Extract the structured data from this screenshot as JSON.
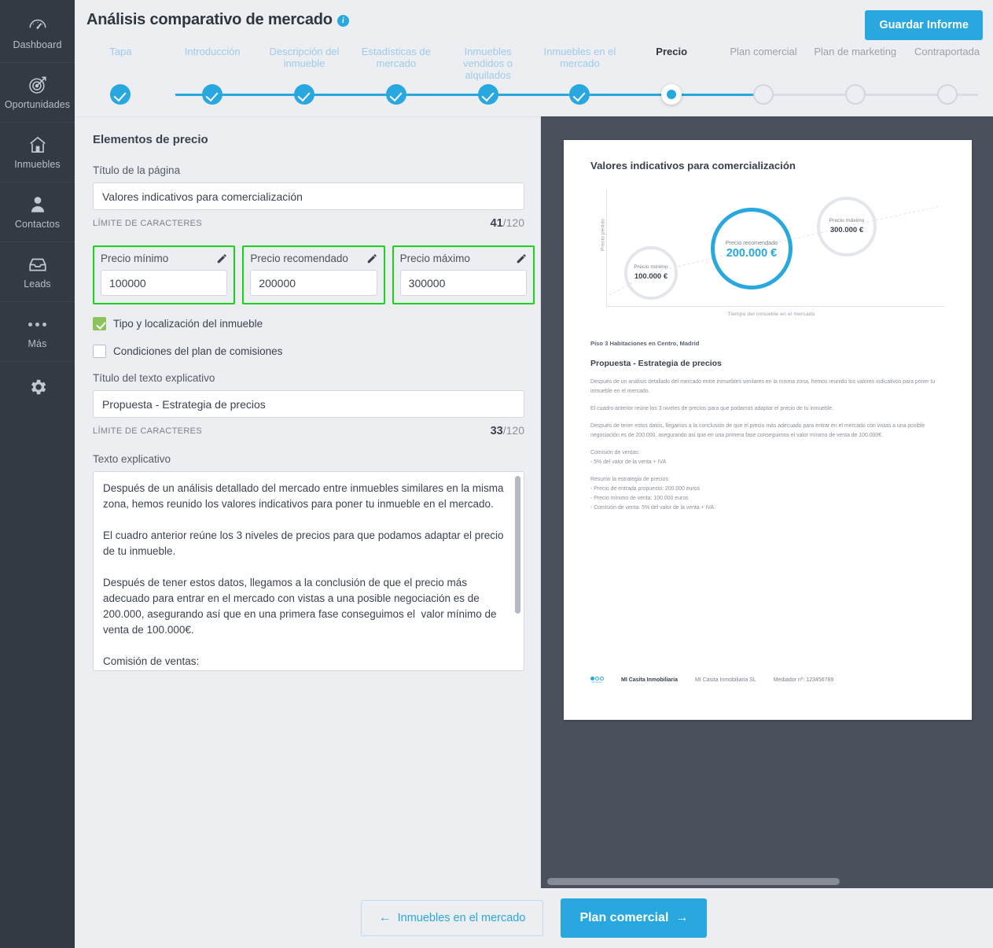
{
  "sidebar": {
    "items": [
      {
        "label": "Dashboard",
        "icon": "gauge-icon"
      },
      {
        "label": "Oportunidades",
        "icon": "target-icon"
      },
      {
        "label": "Inmuebles",
        "icon": "house-icon"
      },
      {
        "label": "Contactos",
        "icon": "person-icon"
      },
      {
        "label": "Leads",
        "icon": "inbox-icon"
      },
      {
        "label": "Más",
        "icon": "ellipsis-icon"
      },
      {
        "label": "",
        "icon": "gear-icon"
      }
    ]
  },
  "header": {
    "title": "Análisis comparativo de mercado",
    "info_icon": "i",
    "save_label": "Guardar Informe"
  },
  "stepper": {
    "steps": [
      {
        "label": "Tapa",
        "state": "done"
      },
      {
        "label": "Introducción",
        "state": "done"
      },
      {
        "label": "Descripción del\ninmueble",
        "state": "done"
      },
      {
        "label": "Estadísticas de\nmercado",
        "state": "done"
      },
      {
        "label": "Inmuebles\nvendidos o\nalquilados",
        "state": "done"
      },
      {
        "label": "Inmuebles en el\nmercado",
        "state": "done"
      },
      {
        "label": "Precio",
        "state": "current"
      },
      {
        "label": "Plan comercial",
        "state": "todo"
      },
      {
        "label": "Plan de marketing",
        "state": "todo"
      },
      {
        "label": "Contraportada",
        "state": "todo"
      }
    ]
  },
  "form": {
    "section_title": "Elementos de precio",
    "page_title_label": "Título de la página",
    "page_title_value": "Valores indicativos para comercialización",
    "page_title_counter_label": "LÍMITE DE CARACTERES",
    "page_title_count": "41",
    "page_title_max": "/120",
    "prices": [
      {
        "name": "Precio mínimo",
        "value": "100000",
        "icon": "pencil-icon"
      },
      {
        "name": "Precio recomendado",
        "value": "200000",
        "icon": "pencil-icon"
      },
      {
        "name": "Precio máximo",
        "value": "300000",
        "icon": "pencil-icon"
      }
    ],
    "checkboxes": [
      {
        "label": "Tipo y localización del inmueble",
        "checked": true
      },
      {
        "label": "Condiciones del plan de comisiones",
        "checked": false
      }
    ],
    "expl_title_label": "Título del texto explicativo",
    "expl_title_value": "Propuesta - Estrategia de precios",
    "expl_title_counter_label": "LÍMITE DE CARACTERES",
    "expl_title_count": "33",
    "expl_title_max": "/120",
    "expl_text_label": "Texto explicativo",
    "expl_text_value": "Después de un análisis detallado del mercado entre inmuebles similares en la misma zona, hemos reunido los valores indicativos para poner tu inmueble en el mercado.\n\nEl cuadro anterior reúne los 3 niveles de precios para que podamos adaptar el precio de tu inmueble.\n\nDespués de tener estos datos, llegamos a la conclusión de que el precio más adecuado para entrar en el mercado con vistas a una posible negociación es de 200.000, asegurando así que en una primera fase conseguimos el  valor mínimo de venta de 100.000€.\n\nComisión de ventas:\n- 5% del valor de la venta + IVA"
  },
  "preview": {
    "doc_title": "Valores indicativos para comercialización",
    "property_line": "Piso 3 Habitaciones en Centro, Madrid",
    "section_heading": "Propuesta - Estrategia de precios",
    "paragraphs": [
      "Después de un análisis detallado del mercado entre inmuebles similares en la misma zona, hemos reunido los valores indicativos para poner tu inmueble en el mercado.",
      "El cuadro anterior reúne los 3 niveles de precios para que podamos adaptar el precio de tu inmueble.",
      "Después de tener estos datos, llegamos a la conclusión de que el precio más adecuado para entrar en el mercado con vistas a una posible negociación es de 200.000, asegurando así que en una primera fase conseguimos el valor mínimo de venta de 100.000€."
    ],
    "commission_heading": "Comisión de ventas:",
    "commission_line": "- 5% del valor de la venta + IVA",
    "summary_heading": "Resumir la estrategia de precios:",
    "summary_lines": [
      "- Precio de entrada propuesto: 200.000 euros",
      "- Precio mínimo de venta: 100.000 euros",
      "- Comisión de venta: 5% del valor de la venta + IVA."
    ],
    "footer": {
      "logo": "mi-casita-logo",
      "logo_text": "MI CASITA",
      "brand": "MI Casita Inmobiliaria",
      "company": "MI Casita Inmobiliaria SL",
      "mediator": "Mediador nº: 123456789"
    }
  },
  "chart_data": {
    "type": "scatter",
    "title": "Valores indicativos para comercialización",
    "xlabel": "Tiempo del inmueble en el mercado",
    "ylabel": "Precio pedido",
    "grid": false,
    "legend": "none",
    "points": [
      {
        "label": "Precio mínimo",
        "value": "100.000 €",
        "numeric": 100000,
        "color": "#e3e6ea",
        "highlight": false
      },
      {
        "label": "Precio recomendado",
        "value": "200.000 €",
        "numeric": 200000,
        "color": "#29a8e0",
        "highlight": true
      },
      {
        "label": "Precio máximo",
        "value": "300.000 €",
        "numeric": 300000,
        "color": "#e3e6ea",
        "highlight": false
      }
    ]
  },
  "footer_nav": {
    "back_label": "Inmuebles en el mercado",
    "back_arrow": "←",
    "next_label": "Plan comercial",
    "next_arrow": "→"
  },
  "colors": {
    "accent": "#29a8e0",
    "highlight_border": "#17d617",
    "sidebar_bg": "#343a44",
    "preview_bg": "#4a505c",
    "checkbox_on": "#8bc45c"
  }
}
